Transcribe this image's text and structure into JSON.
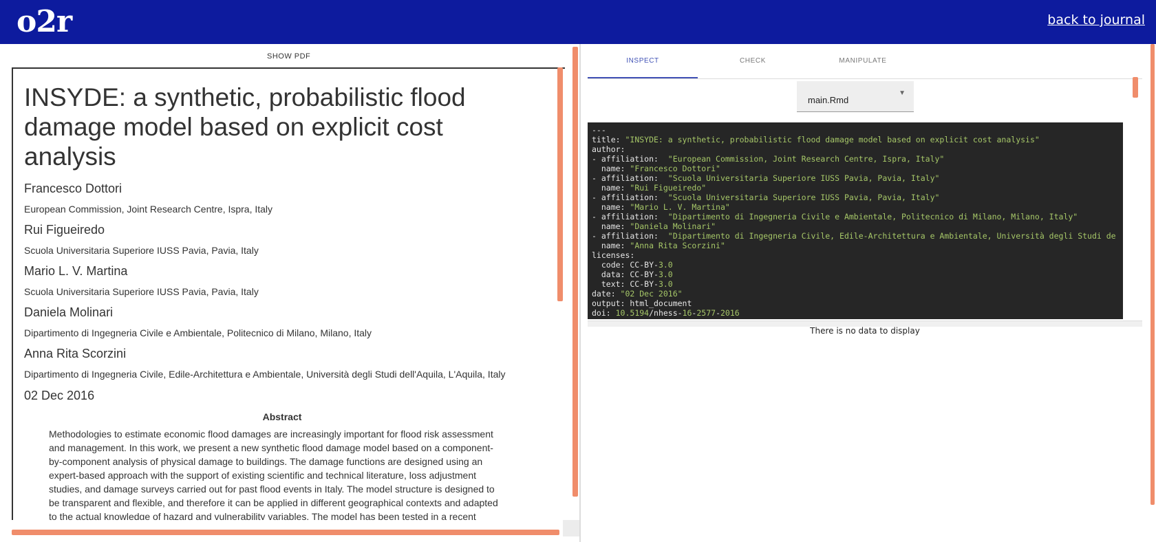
{
  "header": {
    "logo": "o2r",
    "back_link": "back to journal"
  },
  "left": {
    "show_pdf": "SHOW PDF",
    "title": "INSYDE: a synthetic, probabilistic flood damage model based on explicit cost analysis",
    "authors": [
      {
        "name": "Francesco Dottori",
        "affiliation": "European Commission, Joint Research Centre, Ispra, Italy"
      },
      {
        "name": "Rui Figueiredo",
        "affiliation": "Scuola Universitaria Superiore IUSS Pavia, Pavia, Italy"
      },
      {
        "name": "Mario L. V. Martina",
        "affiliation": "Scuola Universitaria Superiore IUSS Pavia, Pavia, Italy"
      },
      {
        "name": "Daniela Molinari",
        "affiliation": "Dipartimento di Ingegneria Civile e Ambientale, Politecnico di Milano, Milano, Italy"
      },
      {
        "name": "Anna Rita Scorzini",
        "affiliation": "Dipartimento di Ingegneria Civile, Edile-Architettura e Ambientale, Università degli Studi dell'Aquila, L'Aquila, Italy"
      }
    ],
    "date": "02 Dec 2016",
    "abstract_heading": "Abstract",
    "abstract_lines": [
      "Methodologies to estimate economic flood damages are increasingly important for flood risk assessment",
      "and management. In this work, we present a new synthetic flood damage model based on a component-",
      "by-component analysis of physical damage to buildings. The damage functions are designed using an",
      "expert-based approach with the support of existing scientific and technical literature, loss adjustment",
      "studies, and damage surveys carried out for past flood events in Italy. The model structure is designed to",
      "be transparent and flexible, and therefore it can be applied in different geographical contexts and adapted",
      "to the actual knowledge of hazard and vulnerability variables.  The model has been tested in a recent"
    ]
  },
  "right": {
    "tabs": [
      "INSPECT",
      "CHECK",
      "MANIPULATE"
    ],
    "active_tab": "INSPECT",
    "file_select": "main.Rmd",
    "code_lines": [
      [
        {
          "t": "---"
        }
      ],
      [
        {
          "t": "title: "
        },
        {
          "t": "\"INSYDE: a synthetic, probabilistic flood damage model based on explicit cost analysis\"",
          "c": "str"
        }
      ],
      [
        {
          "t": "author:"
        }
      ],
      [
        {
          "t": "- affiliation:  "
        },
        {
          "t": "\"European Commission, Joint Research Centre, Ispra, Italy\"",
          "c": "str"
        }
      ],
      [
        {
          "t": "  name: "
        },
        {
          "t": "\"Francesco Dottori\"",
          "c": "str"
        }
      ],
      [
        {
          "t": "- affiliation:  "
        },
        {
          "t": "\"Scuola Universitaria Superiore IUSS Pavia, Pavia, Italy\"",
          "c": "str"
        }
      ],
      [
        {
          "t": "  name: "
        },
        {
          "t": "\"Rui Figueiredo\"",
          "c": "str"
        }
      ],
      [
        {
          "t": "- affiliation:  "
        },
        {
          "t": "\"Scuola Universitaria Superiore IUSS Pavia, Pavia, Italy\"",
          "c": "str"
        }
      ],
      [
        {
          "t": "  name: "
        },
        {
          "t": "\"Mario L. V. Martina\"",
          "c": "str"
        }
      ],
      [
        {
          "t": "- affiliation:  "
        },
        {
          "t": "\"Dipartimento di Ingegneria Civile e Ambientale, Politecnico di Milano, Milano, Italy\"",
          "c": "str"
        }
      ],
      [
        {
          "t": "  name: "
        },
        {
          "t": "\"Daniela Molinari\"",
          "c": "str"
        }
      ],
      [
        {
          "t": "- affiliation:  "
        },
        {
          "t": "\"Dipartimento di Ingegneria Civile, Edile-Architettura e Ambientale, Università degli Studi de",
          "c": "str"
        }
      ],
      [
        {
          "t": "  name: "
        },
        {
          "t": "\"Anna Rita Scorzini\"",
          "c": "str"
        }
      ],
      [
        {
          "t": "licenses:"
        }
      ],
      [
        {
          "t": "  code: CC-BY-"
        },
        {
          "t": "3.0",
          "c": "num"
        }
      ],
      [
        {
          "t": "  data: CC-BY-"
        },
        {
          "t": "3.0",
          "c": "num"
        }
      ],
      [
        {
          "t": "  text: CC-BY-"
        },
        {
          "t": "3.0",
          "c": "num"
        }
      ],
      [
        {
          "t": "date: "
        },
        {
          "t": "\"02 Dec 2016\"",
          "c": "str"
        }
      ],
      [
        {
          "t": "output: html_document"
        }
      ],
      [
        {
          "t": "doi: "
        },
        {
          "t": "10.5194",
          "c": "num"
        },
        {
          "t": "/nhess-"
        },
        {
          "t": "16",
          "c": "num"
        },
        {
          "t": "-"
        },
        {
          "t": "2577",
          "c": "num"
        },
        {
          "t": "-"
        },
        {
          "t": "2016",
          "c": "num"
        }
      ]
    ],
    "no_data": "There is no data to display"
  },
  "colors": {
    "header_bg": "#0d1b9e",
    "scrollbar": "#f08d6b",
    "active_tab": "#3f51b5",
    "code_bg": "#262626",
    "code_string": "#a6c768"
  }
}
